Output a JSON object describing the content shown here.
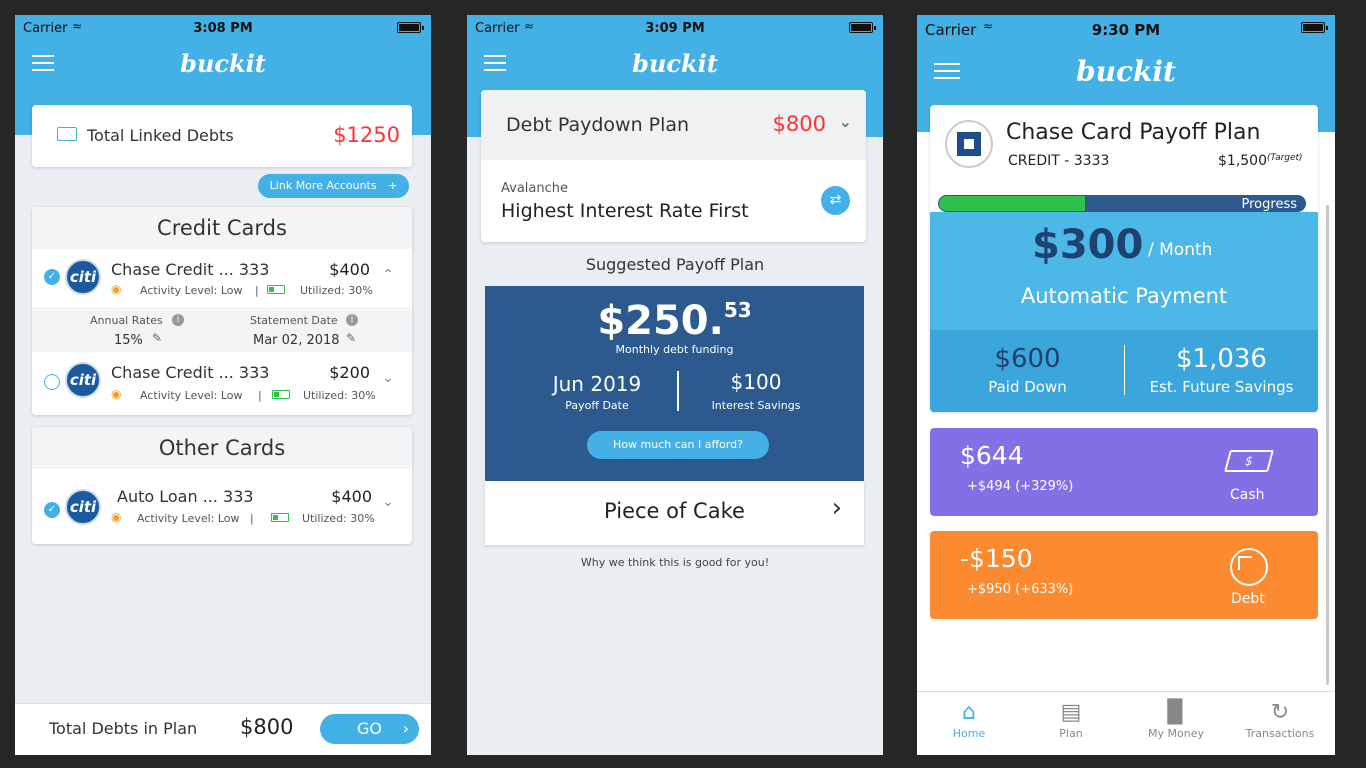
{
  "screen1": {
    "status": {
      "carrier": "Carrier",
      "time": "3:08 PM"
    },
    "logo": "buckit",
    "total_linked_label": "Total Linked Debts",
    "total_linked_value": "$1250",
    "link_more": "Link More Accounts",
    "credit_cards_title": "Credit Cards",
    "cards": [
      {
        "name": "Chase Credit ... 333",
        "amount": "$400",
        "activity": "Activity Level: Low",
        "utilized": "Utilized: 30%"
      },
      {
        "name": "Chase Credit ... 333",
        "amount": "$200",
        "activity": "Activity Level:  Low",
        "utilized": "Utilized: 30%"
      }
    ],
    "annual_rates_label": "Annual Rates",
    "annual_rates_value": "15%",
    "statement_date_label": "Statement Date",
    "statement_date_value": "Mar 02, 2018",
    "other_cards_title": "Other Cards",
    "other": {
      "name": "Auto Loan ... 333",
      "amount": "$400",
      "activity": "Activity Level: Low",
      "utilized": "Utilized: 30%"
    },
    "total_in_plan_label": "Total Debts in Plan",
    "total_in_plan_value": "$800",
    "go": "GO"
  },
  "screen2": {
    "status": {
      "carrier": "Carrier",
      "time": "3:09 PM"
    },
    "logo": "buckit",
    "plan_title": "Debt Paydown Plan",
    "plan_value": "$800",
    "strategy_label": "Avalanche",
    "strategy_value": "Highest Interest Rate First",
    "suggested": "Suggested Payoff Plan",
    "amount_main": "$250.",
    "amount_cents": "53",
    "amount_caption": "Monthly debt funding",
    "payoff_date": "Jun 2019",
    "payoff_date_label": "Payoff Date",
    "interest_savings": "$100",
    "interest_savings_label": "Interest Savings",
    "afford_button": "How much can I afford?",
    "piece_of_cake": "Piece of Cake",
    "why": "Why we think this is good for you!"
  },
  "screen3": {
    "status": {
      "carrier": "Carrier",
      "time": "9:30 PM"
    },
    "logo": "buckit",
    "plan_title": "Chase Card Payoff Plan",
    "credit": "CREDIT - 3333",
    "target_value": "$1,500",
    "target_label": "(Target)",
    "progress_label": "Progress",
    "progress_fraction": 0.4,
    "monthly": "$300",
    "per_month": "/ Month",
    "auto_payment": "Automatic Payment",
    "paid_down": "$600",
    "paid_down_label": "Paid Down",
    "future_savings": "$1,036",
    "future_savings_label": "Est. Future Savings",
    "cash_value": "$644",
    "cash_change": "+$494 (+329%)",
    "cash_label": "Cash",
    "debt_value": "-$150",
    "debt_change": "+$950 (+633%)",
    "debt_label": "Debt",
    "tabs": [
      {
        "label": "Home",
        "icon": "home-icon"
      },
      {
        "label": "Plan",
        "icon": "plan-icon"
      },
      {
        "label": "My Money",
        "icon": "bar-chart-icon"
      },
      {
        "label": "Transactions",
        "icon": "transactions-icon"
      }
    ]
  }
}
